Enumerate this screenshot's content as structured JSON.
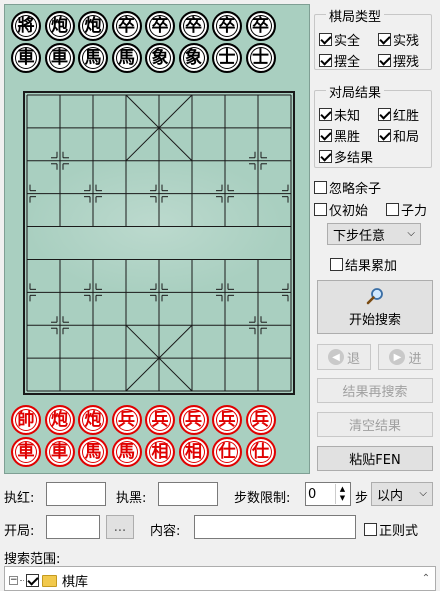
{
  "board": {
    "top_pieces": [
      {
        "text": "將",
        "color": "black"
      },
      {
        "text": "炮",
        "color": "black"
      },
      {
        "text": "炮",
        "color": "black"
      },
      {
        "text": "卒",
        "color": "black"
      },
      {
        "text": "卒",
        "color": "black"
      },
      {
        "text": "卒",
        "color": "black"
      },
      {
        "text": "卒",
        "color": "black"
      },
      {
        "text": "卒",
        "color": "black"
      },
      {
        "text": "車",
        "color": "black"
      },
      {
        "text": "車",
        "color": "black"
      },
      {
        "text": "馬",
        "color": "black"
      },
      {
        "text": "馬",
        "color": "black"
      },
      {
        "text": "象",
        "color": "black"
      },
      {
        "text": "象",
        "color": "black"
      },
      {
        "text": "士",
        "color": "black"
      },
      {
        "text": "士",
        "color": "black"
      }
    ],
    "bottom_pieces": [
      {
        "text": "帥",
        "color": "red"
      },
      {
        "text": "炮",
        "color": "red"
      },
      {
        "text": "炮",
        "color": "red"
      },
      {
        "text": "兵",
        "color": "red"
      },
      {
        "text": "兵",
        "color": "red"
      },
      {
        "text": "兵",
        "color": "red"
      },
      {
        "text": "兵",
        "color": "red"
      },
      {
        "text": "兵",
        "color": "red"
      },
      {
        "text": "車",
        "color": "red"
      },
      {
        "text": "車",
        "color": "red"
      },
      {
        "text": "馬",
        "color": "red"
      },
      {
        "text": "馬",
        "color": "red"
      },
      {
        "text": "相",
        "color": "red"
      },
      {
        "text": "相",
        "color": "red"
      },
      {
        "text": "仕",
        "color": "red"
      },
      {
        "text": "仕",
        "color": "red"
      }
    ],
    "bg_color": "#a9cfc0",
    "red_color": "#e00000"
  },
  "game_type": {
    "title": "棋局类型",
    "options": [
      {
        "label": "实全",
        "checked": true
      },
      {
        "label": "实残",
        "checked": true
      },
      {
        "label": "摆全",
        "checked": true
      },
      {
        "label": "摆残",
        "checked": true
      }
    ]
  },
  "game_result": {
    "title": "对局结果",
    "options": [
      {
        "label": "未知",
        "checked": true
      },
      {
        "label": "红胜",
        "checked": true
      },
      {
        "label": "黑胜",
        "checked": true
      },
      {
        "label": "和局",
        "checked": true
      },
      {
        "label": "多结果",
        "checked": true
      }
    ]
  },
  "options": {
    "ignore_rest": {
      "label": "忽略余子",
      "checked": false
    },
    "initial_only": {
      "label": "仅初始",
      "checked": false
    },
    "sub_force": {
      "label": "子力",
      "checked": false
    },
    "next_move": "下步任意",
    "accumulate": {
      "label": "结果累加",
      "checked": false
    }
  },
  "buttons": {
    "start_search": "开始搜索",
    "back": "退",
    "forward": "进",
    "search_again": "结果再搜索",
    "clear_results": "清空结果",
    "paste_fen": "粘贴FEN"
  },
  "fields": {
    "red_label": "执红:",
    "black_label": "执黑:",
    "step_limit_label": "步数限制:",
    "step_value": "0",
    "step_unit": "步",
    "step_mode": "以内",
    "opening_label": "开局:",
    "browse": "...",
    "content_label": "内容:",
    "regex": {
      "label": "正则式",
      "checked": false
    },
    "scope_label": "搜索范围:"
  },
  "tree": {
    "root_label": "棋库"
  }
}
